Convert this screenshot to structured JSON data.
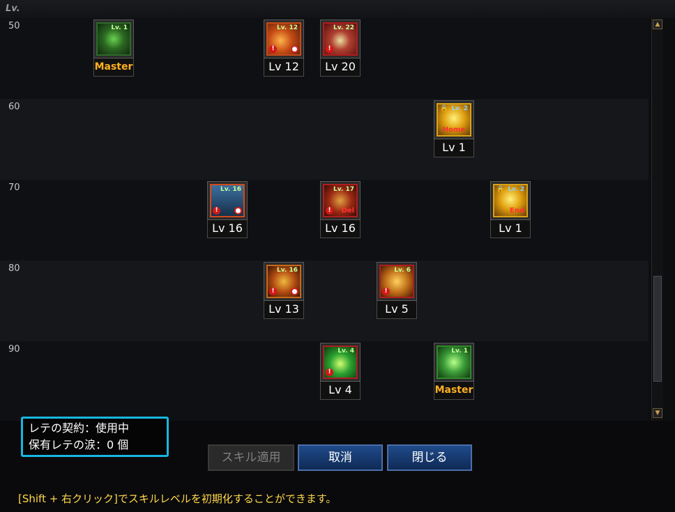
{
  "header": {
    "lv_label": "Lv."
  },
  "rows": [
    {
      "level": "50"
    },
    {
      "level": "60"
    },
    {
      "level": "70"
    },
    {
      "level": "80"
    },
    {
      "level": "90"
    }
  ],
  "skills": [
    {
      "level_row": "50",
      "badge": "Lv. 1",
      "caption": "Master",
      "icon": "green-tentacle-icon",
      "tag": ""
    },
    {
      "level_row": "50",
      "badge": "Lv. 12",
      "caption": "Lv 12",
      "icon": "fire-fist-icon",
      "tag": ""
    },
    {
      "level_row": "50",
      "badge": "Lv. 22",
      "caption": "Lv 20",
      "icon": "raised-arm-icon",
      "tag": ""
    },
    {
      "level_row": "60",
      "badge": "Lv. 2",
      "caption": "Lv 1",
      "icon": "golden-burst-icon",
      "tag": "Home"
    },
    {
      "level_row": "70",
      "badge": "Lv. 16",
      "caption": "Lv 16",
      "icon": "blue-waterfall-icon",
      "tag": ""
    },
    {
      "level_row": "70",
      "badge": "Lv. 17",
      "caption": "Lv 16",
      "icon": "fire-web-icon",
      "tag": "Del"
    },
    {
      "level_row": "70",
      "badge": "Lv. 2",
      "caption": "Lv 1",
      "icon": "cross-slash-icon",
      "tag": "End"
    },
    {
      "level_row": "80",
      "badge": "Lv. 16",
      "caption": "Lv 13",
      "icon": "chain-fire-icon",
      "tag": ""
    },
    {
      "level_row": "80",
      "badge": "Lv. 6",
      "caption": "Lv 5",
      "icon": "golden-wings-icon",
      "tag": ""
    },
    {
      "level_row": "90",
      "badge": "Lv. 4",
      "caption": "Lv 4",
      "icon": "green-aura-icon",
      "tag": ""
    },
    {
      "level_row": "90",
      "badge": "Lv. 1",
      "caption": "Master",
      "icon": "green-dragon-icon",
      "tag": ""
    }
  ],
  "status": {
    "line1": "レテの契約：使用中",
    "line2": "保有レテの涙：0 個"
  },
  "buttons": {
    "apply": "スキル適用",
    "cancel": "取消",
    "close": "閉じる"
  },
  "help_text": "[Shift + 右クリック]でスキルレベルを初期化することができます。",
  "colors": {
    "accent_border": "#18b7e0",
    "help_text": "#ffd84a",
    "master": "#ffb020",
    "primary_button": "#1f4a8a"
  }
}
